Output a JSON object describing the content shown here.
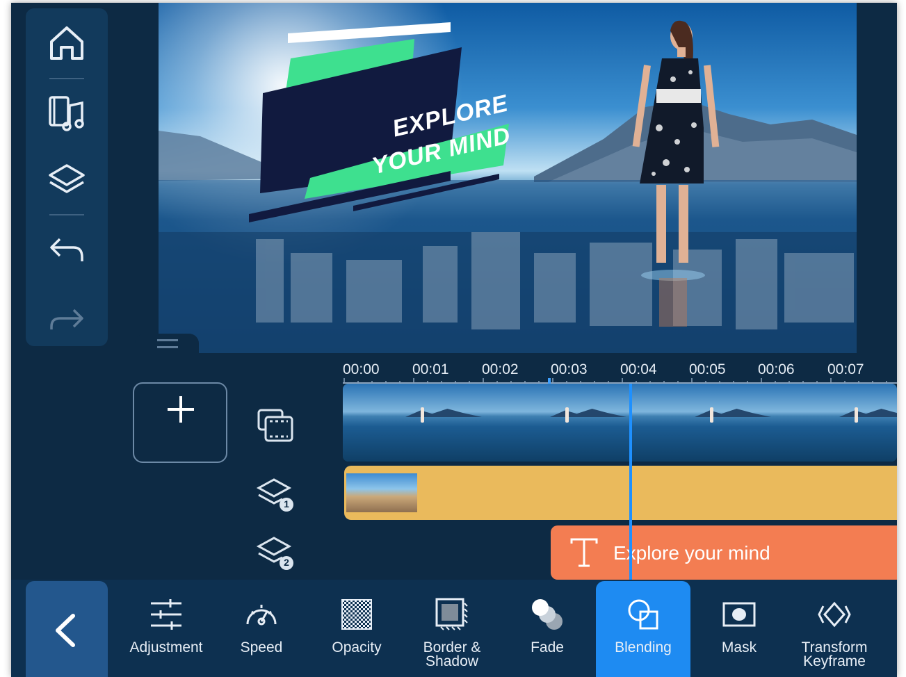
{
  "preview": {
    "title_line1": "EXPLORE",
    "title_line2": "YOUR MIND"
  },
  "left_toolbar": {
    "items": [
      "home-icon",
      "media-music-icon",
      "layers-icon",
      "undo-icon",
      "redo-icon"
    ]
  },
  "timeline": {
    "ruler": [
      "00:00",
      "00:01",
      "00:02",
      "00:03",
      "00:04",
      "00:05",
      "00:06",
      "00:07"
    ],
    "tracks": [
      {
        "icon": "media-track-icon"
      },
      {
        "icon": "layer-1-icon",
        "badge": "1"
      },
      {
        "icon": "layer-2-icon",
        "badge": "2"
      }
    ],
    "text_clip": "Explore your mind"
  },
  "bottom_toolbar": {
    "back_icon": "chevron-left-icon",
    "tools": [
      {
        "label": "Adjustment",
        "icon": "sliders-icon"
      },
      {
        "label": "Speed",
        "icon": "speedometer-icon"
      },
      {
        "label": "Opacity",
        "icon": "checkerboard-icon"
      },
      {
        "label": "Border & Shadow",
        "icon": "border-shadow-icon"
      },
      {
        "label": "Fade",
        "icon": "fade-icon"
      },
      {
        "label": "Blending",
        "icon": "blending-icon",
        "active": true
      },
      {
        "label": "Mask",
        "icon": "mask-icon"
      },
      {
        "label": "Transform Keyframe",
        "icon": "transform-keyframe-icon"
      }
    ]
  },
  "colors": {
    "background": "#0d2a44",
    "accent_active": "#1e8bf2",
    "overlay_clip": "#eaba5c",
    "text_clip": "#f37d52",
    "playhead": "#1e90ff",
    "title_green": "#3ee08f",
    "title_navy": "#111a3f"
  }
}
